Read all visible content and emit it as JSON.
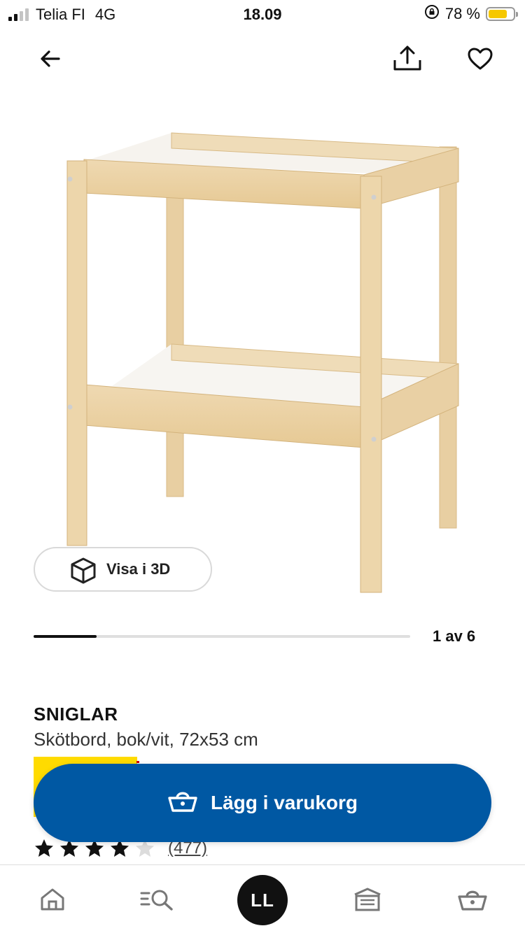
{
  "status_bar": {
    "carrier": "Telia FI",
    "network": "4G",
    "time": "18.09",
    "battery": "78 %",
    "battery_level": 0.78
  },
  "nav": {
    "back_icon": "arrow-left-icon",
    "share_icon": "share-icon",
    "favorite_icon": "heart-icon"
  },
  "gallery": {
    "view_3d_label": "Visa i 3D",
    "counter": "1 av 6",
    "current": 1,
    "total": 6
  },
  "product": {
    "name": "SNIGLAR",
    "description": "Skötbord, bok/vit, 72x53 cm",
    "rating": 4,
    "rating_max": 5,
    "review_count": "(477)"
  },
  "cart_button": {
    "label": "Lägg i varukorg",
    "icon": "basket-icon"
  },
  "colors": {
    "primary_blue": "#0058a3",
    "price_yellow": "#ffdb00",
    "wood": "#ecd3a9"
  },
  "tabbar": {
    "items": [
      {
        "name": "home",
        "icon": "home-icon"
      },
      {
        "name": "search",
        "icon": "search-list-icon"
      },
      {
        "name": "profile",
        "initials": "LL"
      },
      {
        "name": "store",
        "icon": "store-icon"
      },
      {
        "name": "cart",
        "icon": "basket-icon"
      }
    ]
  }
}
